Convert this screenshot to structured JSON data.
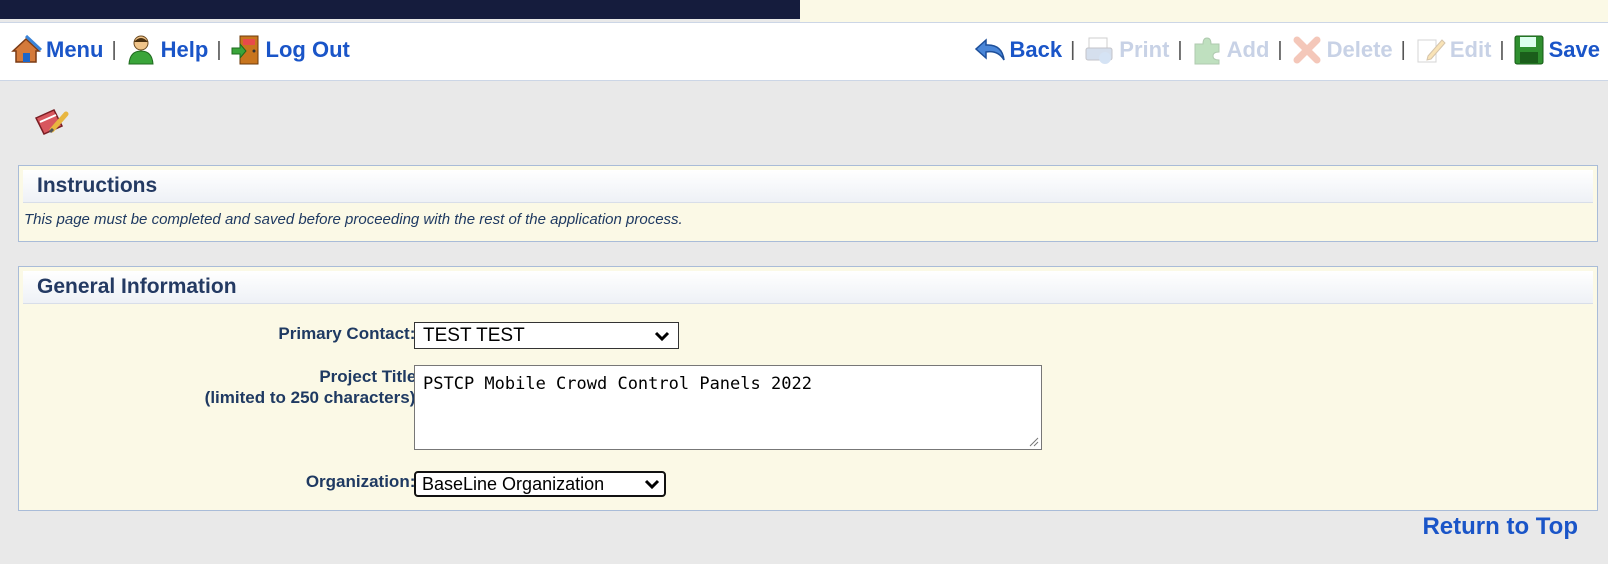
{
  "toolbar": {
    "left": [
      {
        "label": "Menu",
        "icon": "house-icon"
      },
      {
        "label": "Help",
        "icon": "help-person-icon"
      },
      {
        "label": "Log Out",
        "icon": "logout-door-icon"
      }
    ],
    "right": [
      {
        "label": "Back",
        "icon": "back-arrow-icon",
        "enabled": true
      },
      {
        "label": "Print",
        "icon": "printer-icon",
        "enabled": false
      },
      {
        "label": "Add",
        "icon": "add-puzzle-icon",
        "enabled": false
      },
      {
        "label": "Delete",
        "icon": "delete-x-icon",
        "enabled": false
      },
      {
        "label": "Edit",
        "icon": "edit-pencil-icon",
        "enabled": false
      },
      {
        "label": "Save",
        "icon": "save-floppy-icon",
        "enabled": true
      }
    ],
    "separator": "|"
  },
  "instructions": {
    "title": "Instructions",
    "text": "This page must be completed and saved before proceeding with the rest of the application process."
  },
  "general": {
    "title": "General Information",
    "primary_contact": {
      "label": "Primary Contact:",
      "required": "*",
      "value": "TEST TEST"
    },
    "project_title": {
      "label_line1": "Project Title:",
      "label_line2": "(limited to 250 characters)",
      "required": "*",
      "value": "PSTCP Mobile Crowd Control Panels 2022"
    },
    "organization": {
      "label": "Organization:",
      "required": "*",
      "value": "BaseLine Organization"
    }
  },
  "footer": {
    "return_to_top": "Return to Top"
  },
  "colors": {
    "link": "#1a55c8",
    "panel_bg": "#fbf9e6",
    "required": "#d22"
  }
}
